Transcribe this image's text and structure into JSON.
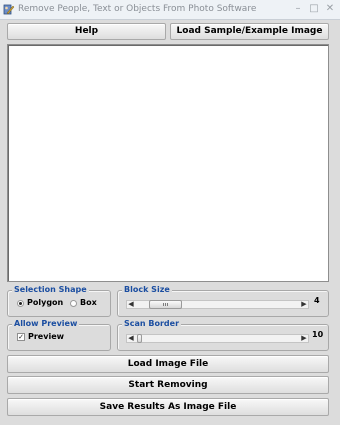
{
  "window": {
    "title": "Remove People, Text or Objects From Photo Software",
    "min_glyph": "–",
    "max_glyph": "□",
    "close_glyph": "✕"
  },
  "toolbar": {
    "help_label": "Help",
    "load_sample_label": "Load Sample/Example Image"
  },
  "selection_shape": {
    "label": "Selection Shape",
    "options": [
      {
        "label": "Polygon",
        "selected": true
      },
      {
        "label": "Box",
        "selected": false
      }
    ]
  },
  "allow_preview": {
    "label": "Allow Preview",
    "checkbox_label": "Preview",
    "checked": true,
    "check_glyph": "✓"
  },
  "block_size": {
    "label": "Block Size",
    "value": "4",
    "left_arrow": "◀",
    "right_arrow": "▶"
  },
  "scan_border": {
    "label": "Scan Border",
    "value": "10",
    "left_arrow": "◀",
    "right_arrow": "▶"
  },
  "actions": {
    "load_image_label": "Load Image File",
    "start_removing_label": "Start Removing",
    "save_results_label": "Save Results As Image File"
  }
}
